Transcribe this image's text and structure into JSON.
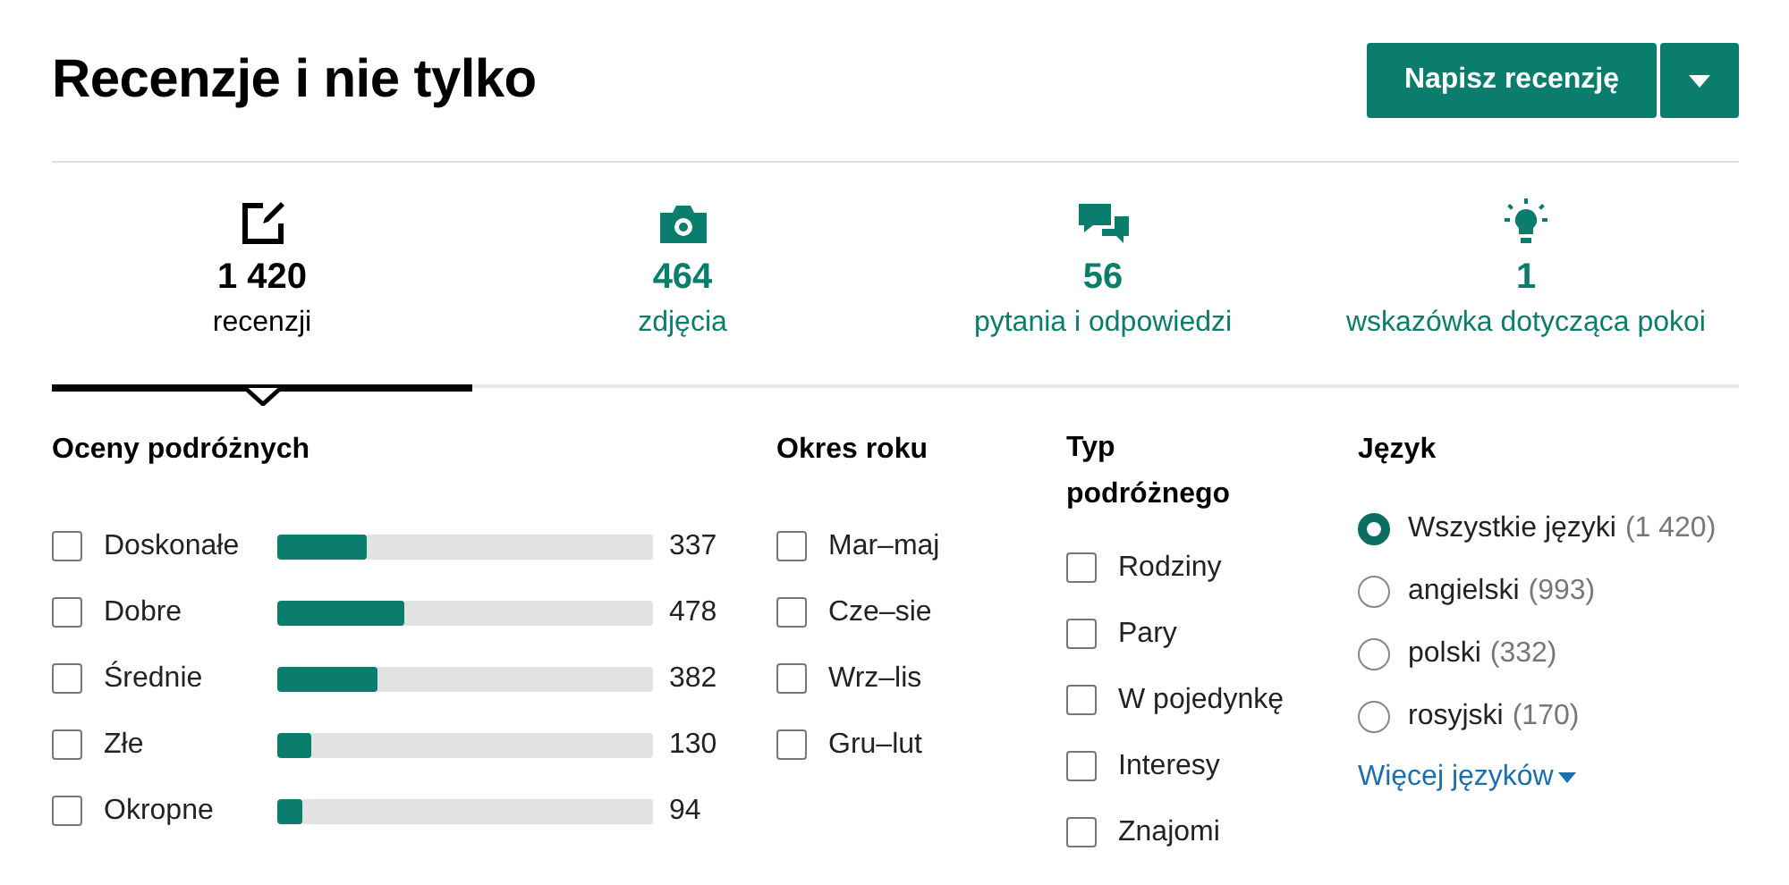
{
  "title": "Recenzje i nie tylko",
  "write_button": {
    "label": "Napisz recenzję"
  },
  "tabs": [
    {
      "kind": "edit",
      "count": "1 420",
      "label": "recenzji",
      "selected": true
    },
    {
      "kind": "camera",
      "count": "464",
      "label": "zdjęcia",
      "selected": false
    },
    {
      "kind": "chat",
      "count": "56",
      "label": "pytania i odpowiedzi",
      "selected": false
    },
    {
      "kind": "bulb",
      "count": "1",
      "label": "wskazówka dotycząca pokoi",
      "selected": false
    }
  ],
  "ratings": {
    "heading": "Oceny podróżnych",
    "items": [
      {
        "label": "Doskonałe",
        "count": "337",
        "level": 0.237,
        "checked": false
      },
      {
        "label": "Dobre",
        "count": "478",
        "level": 0.337,
        "checked": false
      },
      {
        "label": "Średnie",
        "count": "382",
        "level": 0.269,
        "checked": false
      },
      {
        "label": "Złe",
        "count": "130",
        "level": 0.092,
        "checked": false
      },
      {
        "label": "Okropne",
        "count": "94",
        "level": 0.066,
        "checked": false
      }
    ]
  },
  "season": {
    "heading": "Okres roku",
    "items": [
      {
        "label": "Mar–maj",
        "checked": false
      },
      {
        "label": "Cze–sie",
        "checked": false
      },
      {
        "label": "Wrz–lis",
        "checked": false
      },
      {
        "label": "Gru–lut",
        "checked": false
      }
    ]
  },
  "traveler_type": {
    "heading": "Typ podróżnego",
    "items": [
      {
        "label": "Rodziny",
        "checked": false
      },
      {
        "label": "Pary",
        "checked": false
      },
      {
        "label": "W pojedynkę",
        "checked": false
      },
      {
        "label": "Interesy",
        "checked": false
      },
      {
        "label": "Znajomi",
        "checked": false
      }
    ]
  },
  "language": {
    "heading": "Język",
    "items": [
      {
        "label": "Wszystkie języki",
        "count": "(1 420)",
        "selected": true
      },
      {
        "label": "angielski",
        "count": "(993)",
        "selected": false
      },
      {
        "label": "polski",
        "count": "(332)",
        "selected": false
      },
      {
        "label": "rosyjski",
        "count": "(170)",
        "selected": false
      }
    ],
    "more_link": "Więcej języków"
  }
}
